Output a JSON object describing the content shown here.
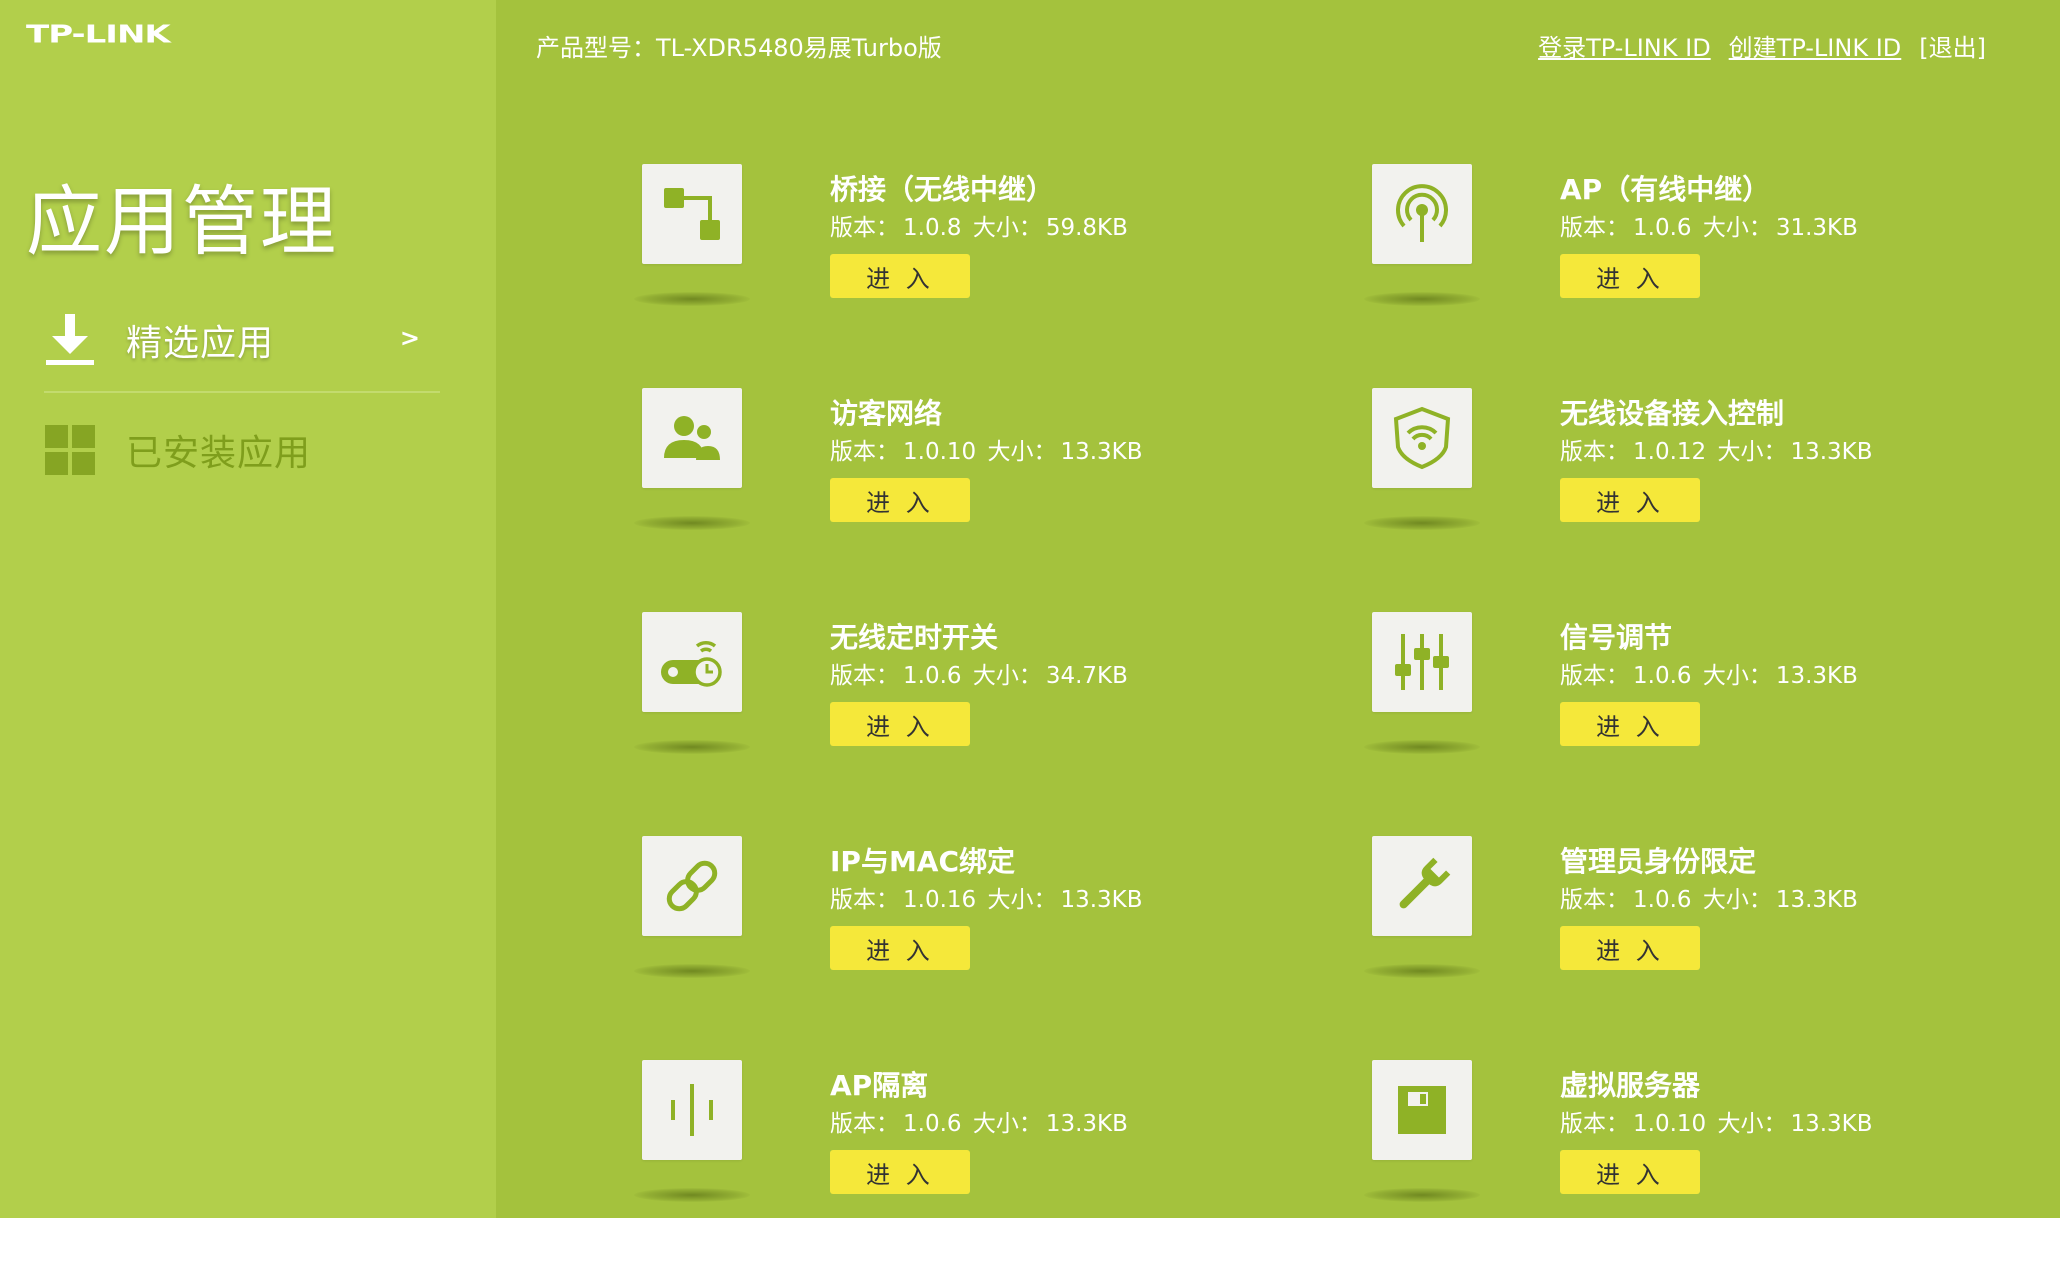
{
  "brand": {
    "logo_text": "TP-LINK"
  },
  "sidebar": {
    "title": "应用管理",
    "nav": [
      {
        "label": "精选应用",
        "arrow": ">"
      },
      {
        "label": "已安装应用"
      }
    ]
  },
  "header": {
    "model": "产品型号：TL-XDR5480易展Turbo版",
    "login_link": "登录TP-LINK ID",
    "create_link": "创建TP-LINK ID",
    "logout": "[退出]"
  },
  "labels": {
    "version_prefix": "版本：",
    "size_prefix": "大小：",
    "enter_button": "进 入"
  },
  "apps": [
    {
      "name": "桥接（无线中继）",
      "version": "1.0.8",
      "size": "59.8KB",
      "icon": "bridge-icon"
    },
    {
      "name": "AP（有线中继）",
      "version": "1.0.6",
      "size": "31.3KB",
      "icon": "ap-signal-icon"
    },
    {
      "name": "访客网络",
      "version": "1.0.10",
      "size": "13.3KB",
      "icon": "guest-users-icon"
    },
    {
      "name": "无线设备接入控制",
      "version": "1.0.12",
      "size": "13.3KB",
      "icon": "wifi-shield-icon"
    },
    {
      "name": "无线定时开关",
      "version": "1.0.6",
      "size": "34.7KB",
      "icon": "wireless-timer-icon"
    },
    {
      "name": "信号调节",
      "version": "1.0.6",
      "size": "13.3KB",
      "icon": "sliders-icon"
    },
    {
      "name": "IP与MAC绑定",
      "version": "1.0.16",
      "size": "13.3KB",
      "icon": "link-icon"
    },
    {
      "name": "管理员身份限定",
      "version": "1.0.6",
      "size": "13.3KB",
      "icon": "wrench-icon"
    },
    {
      "name": "AP隔离",
      "version": "1.0.6",
      "size": "13.3KB",
      "icon": "ap-isolation-icon"
    },
    {
      "name": "虚拟服务器",
      "version": "1.0.10",
      "size": "13.3KB",
      "icon": "virtual-server-icon"
    }
  ],
  "colors": {
    "main_bg": "#a4c23d",
    "sidebar_bg": "#b2cf4b",
    "icon_green": "#8fb226",
    "button_yellow": "#f5e83a"
  }
}
